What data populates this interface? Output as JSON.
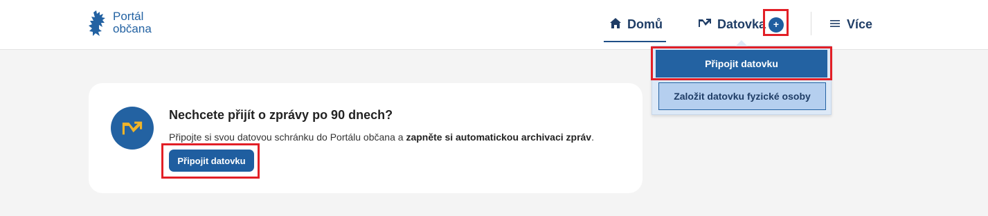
{
  "header": {
    "logo": {
      "line1": "Portál",
      "line2": "občana",
      "icon": "lion-emblem-icon"
    },
    "nav": {
      "home": {
        "label": "Domů",
        "icon": "home-icon"
      },
      "datovka": {
        "label": "Datovka",
        "icon": "datovka-icon",
        "plus": "+"
      },
      "more": {
        "label": "Více",
        "icon": "menu-icon"
      }
    }
  },
  "dropdown": {
    "primary": "Připojit datovku",
    "secondary": "Založit datovku fyzické osoby"
  },
  "card": {
    "title": "Nechcete přijít o zprávy po 90 dnech?",
    "text_before": "Připojte si svou datovou schránku do Portálu občana a ",
    "text_bold": "zapněte si automatickou archivaci zpráv",
    "text_after": ".",
    "button": "Připojit datovku",
    "icon": "datovka-icon"
  },
  "colors": {
    "brand": "#2362a2",
    "highlight": "#e21f26",
    "accent_icon": "#f0b429"
  }
}
